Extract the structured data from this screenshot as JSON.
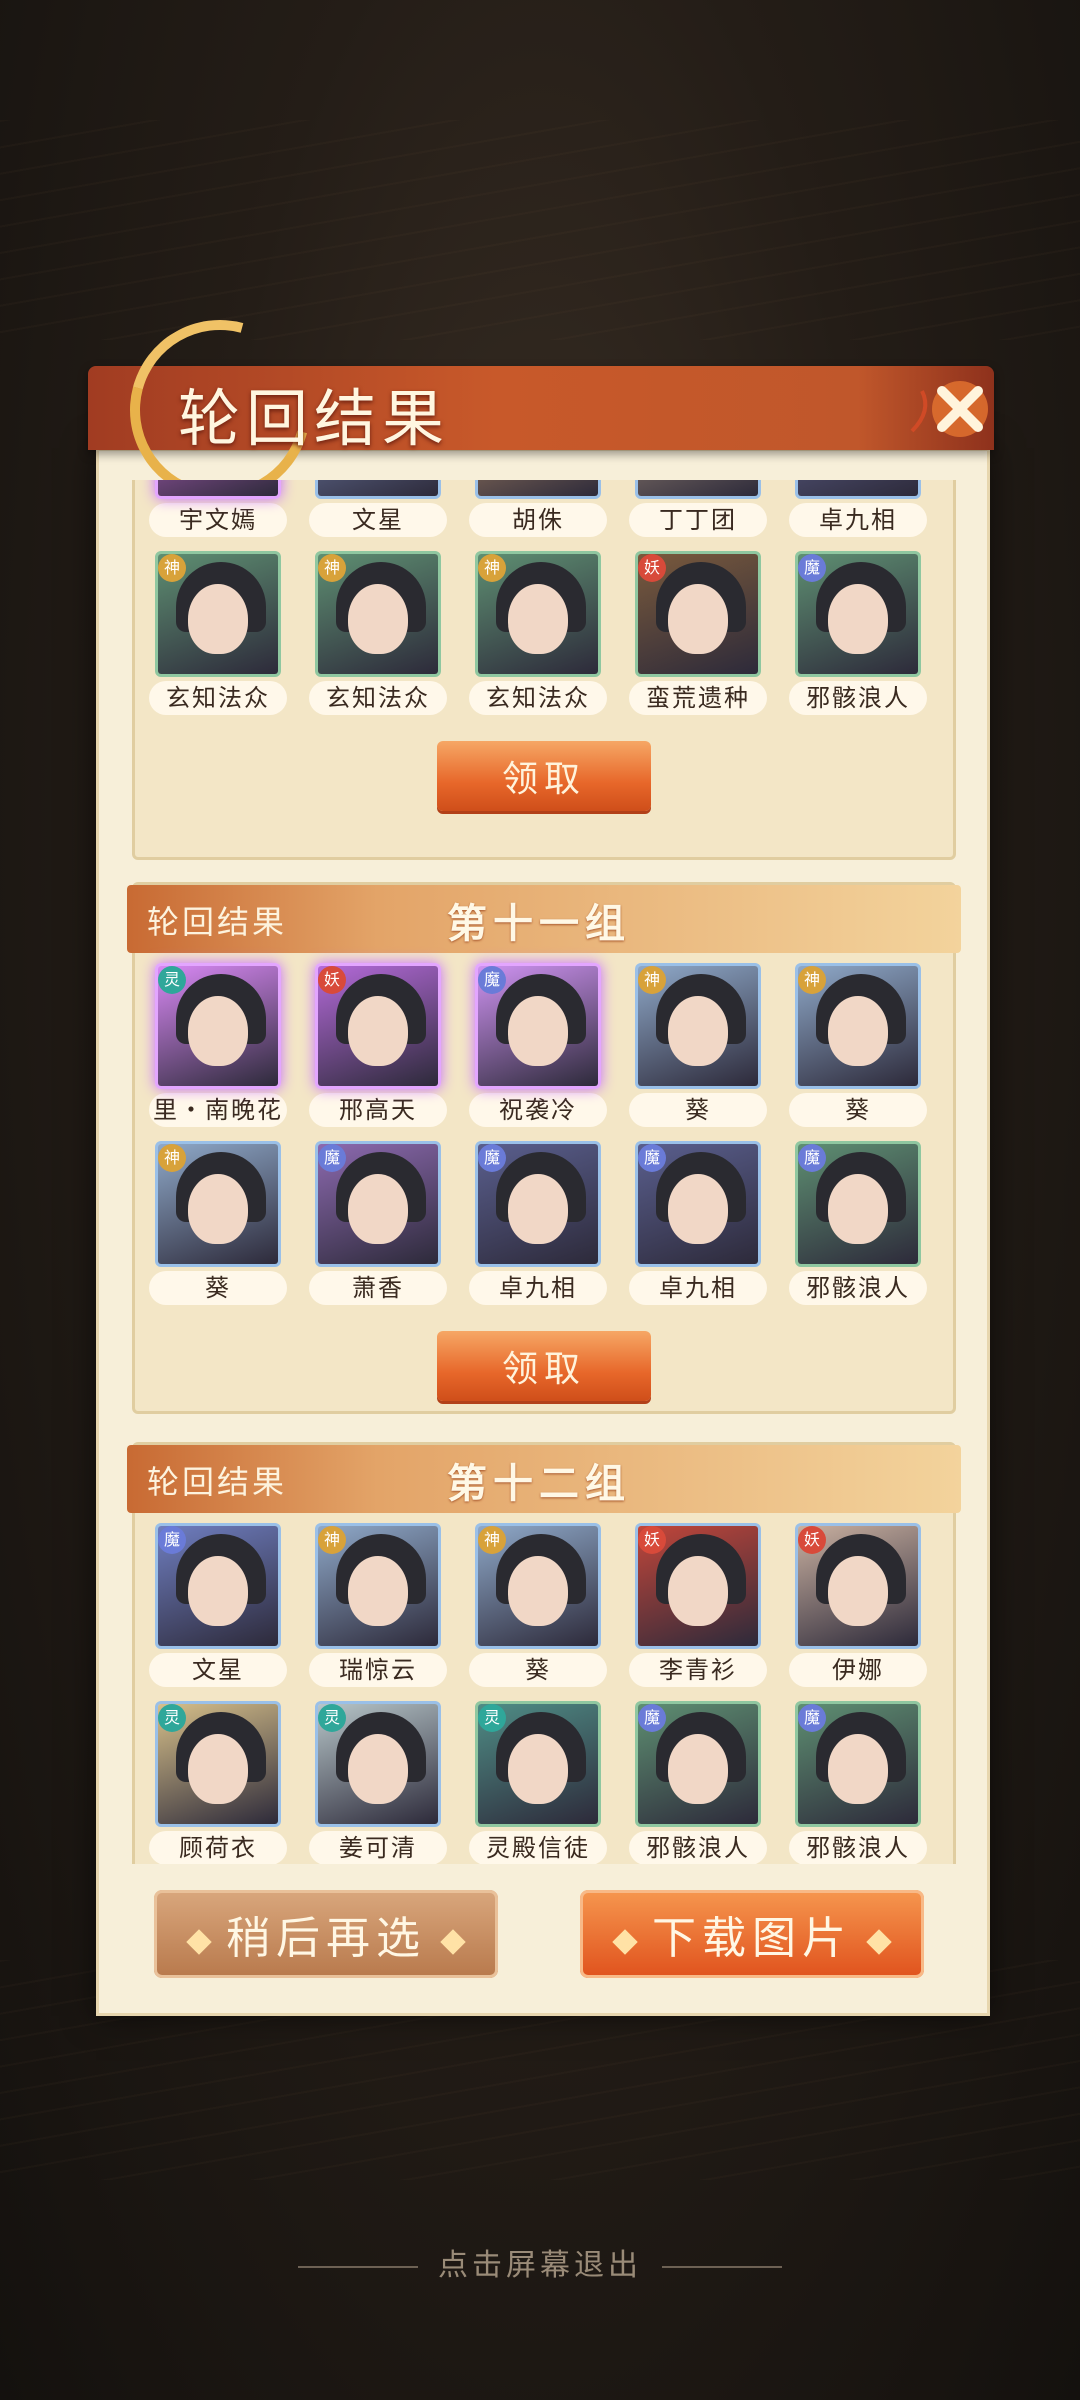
{
  "title": "轮回结果",
  "claim_label": "领取",
  "group_label": "轮回结果",
  "groups": [
    {
      "number_label": "",
      "rows": [
        [
          {
            "name": "宇文嫣",
            "badge": "",
            "frame": "purple",
            "tone": "#d86fe2"
          },
          {
            "name": "文星",
            "badge": "",
            "frame": "blue",
            "tone": "#7d8fbf"
          },
          {
            "name": "胡侏",
            "badge": "",
            "frame": "blue",
            "tone": "#c79b6e"
          },
          {
            "name": "丁丁团",
            "badge": "",
            "frame": "blue",
            "tone": "#b79f86"
          },
          {
            "name": "卓九相",
            "badge": "",
            "frame": "blue",
            "tone": "#6a6fa0"
          }
        ],
        [
          {
            "name": "玄知法众",
            "badge": "神",
            "frame": "green",
            "tone": "#5e8f72"
          },
          {
            "name": "玄知法众",
            "badge": "神",
            "frame": "green",
            "tone": "#5e8f72"
          },
          {
            "name": "玄知法众",
            "badge": "神",
            "frame": "green",
            "tone": "#5e8f72"
          },
          {
            "name": "蛮荒遗种",
            "badge": "妖",
            "frame": "green",
            "tone": "#7a5a3c"
          },
          {
            "name": "邪骸浪人",
            "badge": "魔",
            "frame": "green",
            "tone": "#5e8f72"
          }
        ]
      ]
    },
    {
      "number_label": "第十一组",
      "rows": [
        [
          {
            "name": "里・南晚花",
            "badge": "灵",
            "frame": "purple",
            "tone": "#d989f5"
          },
          {
            "name": "邢高天",
            "badge": "妖",
            "frame": "purple",
            "tone": "#b46ad9"
          },
          {
            "name": "祝袭冷",
            "badge": "魔",
            "frame": "purple",
            "tone": "#cf93f2"
          },
          {
            "name": "葵",
            "badge": "神",
            "frame": "blue",
            "tone": "#8fa9c9"
          },
          {
            "name": "葵",
            "badge": "神",
            "frame": "blue",
            "tone": "#8fa9c9"
          }
        ],
        [
          {
            "name": "葵",
            "badge": "神",
            "frame": "blue",
            "tone": "#8fa9c9"
          },
          {
            "name": "萧香",
            "badge": "魔",
            "frame": "blue",
            "tone": "#8d6ab0"
          },
          {
            "name": "卓九相",
            "badge": "魔",
            "frame": "blue",
            "tone": "#5a5f8e"
          },
          {
            "name": "卓九相",
            "badge": "魔",
            "frame": "blue",
            "tone": "#5a5f8e"
          },
          {
            "name": "邪骸浪人",
            "badge": "魔",
            "frame": "green",
            "tone": "#5e8f72"
          }
        ]
      ]
    },
    {
      "number_label": "第十二组",
      "rows": [
        [
          {
            "name": "文星",
            "badge": "魔",
            "frame": "blue",
            "tone": "#6f7ec0"
          },
          {
            "name": "瑞惊云",
            "badge": "神",
            "frame": "blue",
            "tone": "#8fa9c9"
          },
          {
            "name": "葵",
            "badge": "神",
            "frame": "blue",
            "tone": "#8fa9c9"
          },
          {
            "name": "李青衫",
            "badge": "妖",
            "frame": "blue",
            "tone": "#c2463a"
          },
          {
            "name": "伊娜",
            "badge": "妖",
            "frame": "blue",
            "tone": "#c9b0a0"
          }
        ],
        [
          {
            "name": "顾荷衣",
            "badge": "灵",
            "frame": "blue",
            "tone": "#d7c08a"
          },
          {
            "name": "姜可清",
            "badge": "灵",
            "frame": "blue",
            "tone": "#b7c6c9"
          },
          {
            "name": "灵殿信徒",
            "badge": "灵",
            "frame": "green",
            "tone": "#4f8d86"
          },
          {
            "name": "邪骸浪人",
            "badge": "魔",
            "frame": "green",
            "tone": "#5e8f72"
          },
          {
            "name": "邪骸浪人",
            "badge": "魔",
            "frame": "green",
            "tone": "#5e8f72"
          }
        ]
      ]
    }
  ],
  "buttons": {
    "later": "稍后再选",
    "download": "下载图片"
  },
  "exit_hint": "点击屏幕退出",
  "colors": {
    "accent": "#e0521d",
    "panel": "#f7efd9",
    "title_bar": "#c0572b"
  }
}
